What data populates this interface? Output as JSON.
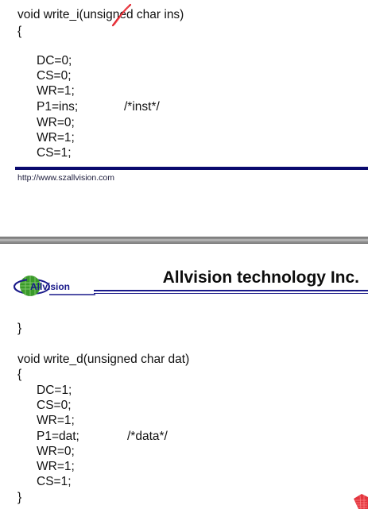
{
  "page1": {
    "code_lines": [
      "void write_i(unsigned char ins)",
      "{",
      "DC=0;",
      "CS=0;",
      "WR=1;",
      "P1=ins;",
      "WR=0;",
      "WR=1;",
      "CS=1;"
    ],
    "comment": "/*inst*/",
    "footer_url": "http://www.szallvision.com"
  },
  "page2": {
    "logo_text": "Allvision",
    "company": "Allvision technology Inc.",
    "code_lines": [
      "}",
      "void write_d(unsigned char dat)",
      "{",
      "DC=1;",
      "CS=0;",
      "WR=1;",
      "P1=dat;",
      "WR=0;",
      "WR=1;",
      "CS=1;",
      "}"
    ],
    "comment": "/*data*/"
  },
  "colors": {
    "rule": "#0a0a6e",
    "logo_green": "#3a9a2a",
    "logo_blue": "#1a1a8a",
    "annotation_red": "#e0202a"
  }
}
